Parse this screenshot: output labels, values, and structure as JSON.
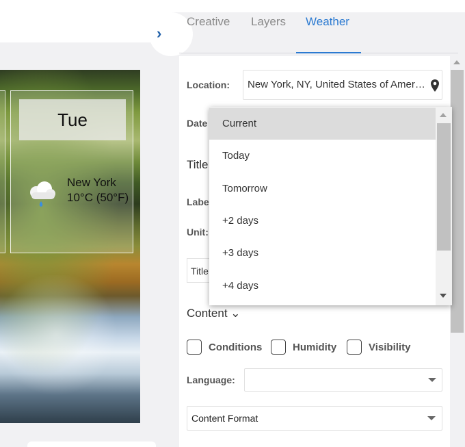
{
  "canvas": {
    "tile": {
      "day": "Tue",
      "city": "New York",
      "temperature": "10°C (50°F)",
      "icon": "rain-cloud-icon"
    }
  },
  "tabs": [
    {
      "label": "Creative",
      "active": false
    },
    {
      "label": "Layers",
      "active": false
    },
    {
      "label": "Weather",
      "active": true
    }
  ],
  "panel": {
    "location_label": "Location:",
    "location_value": "New York, NY, United States of Amer…",
    "date_label": "Date",
    "title_label": "Title",
    "label_label": "Labe",
    "unit_label": "Unit:",
    "title_input_value": "Title",
    "content_toggle": "Content ⌄",
    "checkboxes": [
      {
        "label": "Conditions",
        "checked": false
      },
      {
        "label": "Humidity",
        "checked": false
      },
      {
        "label": "Visibility",
        "checked": false
      }
    ],
    "language_label": "Language:",
    "language_value": "",
    "content_format": "Content Format"
  },
  "date_dropdown": {
    "selected": "Current",
    "options": [
      "Current",
      "Today",
      "Tomorrow",
      "+2 days",
      "+3 days",
      "+4 days"
    ]
  },
  "colors": {
    "accent": "#2b7ad1",
    "panel_bg": "#f1f1f3"
  }
}
